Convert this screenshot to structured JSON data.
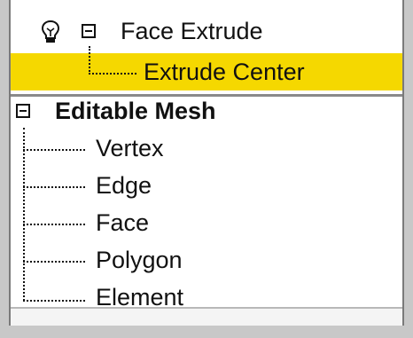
{
  "stack": {
    "modifier": {
      "name": "Face Extrude",
      "children": [
        {
          "label": "Extrude Center",
          "selected": true
        }
      ]
    },
    "base": {
      "name": "Editable Mesh",
      "children": [
        {
          "label": "Vertex"
        },
        {
          "label": "Edge"
        },
        {
          "label": "Face"
        },
        {
          "label": "Polygon"
        },
        {
          "label": "Element"
        }
      ]
    }
  },
  "colors": {
    "selection": "#f5d800"
  },
  "icons": {
    "modifier_toggle": "lightbulb-icon",
    "expander": "minus-box-icon"
  }
}
